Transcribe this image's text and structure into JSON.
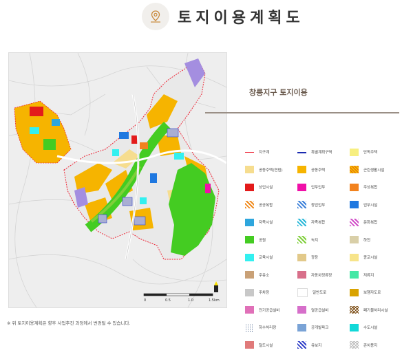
{
  "header": {
    "title": "토지이용계획도"
  },
  "subtitle": "창릉지구 토지이용",
  "note": "※ 위 토지이용계획은 향후 사업추진 과정에서 변경될 수 있습니다.",
  "scale": {
    "ticks": [
      "0",
      "0.5",
      "1.0",
      "1.5km"
    ]
  },
  "legend": [
    {
      "label": "지구계",
      "kind": "redline"
    },
    {
      "label": "특별계획구역",
      "kind": "navyline"
    },
    {
      "label": "단독주택",
      "color": "#f7ef80"
    },
    {
      "label": "공동주택(연립)",
      "color": "#f6dd8f"
    },
    {
      "label": "공동주택",
      "color": "#f6b400"
    },
    {
      "label": "근린생활시설",
      "kind": "cross"
    },
    {
      "label": "상업시설",
      "color": "#e31b1b"
    },
    {
      "label": "업무업무",
      "color": "#f010a8"
    },
    {
      "label": "주상복합",
      "color": "#f2821e"
    },
    {
      "label": "공공복합",
      "kind": "hatch-o"
    },
    {
      "label": "창업업무",
      "kind": "hatch-b"
    },
    {
      "label": "업무시설",
      "color": "#1f78e0"
    },
    {
      "label": "자족시설",
      "color": "#2ea6dd"
    },
    {
      "label": "자족복합",
      "kind": "hatch-c"
    },
    {
      "label": "문화복합",
      "kind": "hatch-m"
    },
    {
      "label": "공원",
      "color": "#44cc22"
    },
    {
      "label": "녹지",
      "kind": "hatch-g"
    },
    {
      "label": "하천",
      "color": "#d9cfa8"
    },
    {
      "label": "교육시설",
      "color": "#33f0f0"
    },
    {
      "label": "광장",
      "color": "#e2c98a"
    },
    {
      "label": "종교시설",
      "color": "#f7e48a"
    },
    {
      "label": "주유소",
      "color": "#c9a177"
    },
    {
      "label": "자동차정류장",
      "color": "#d86f8a"
    },
    {
      "label": "저류지",
      "color": "#44e8a6"
    },
    {
      "label": "주차장",
      "color": "#c8c8c8"
    },
    {
      "label": "일반도로",
      "color": "#ffffff"
    },
    {
      "label": "보행자도로",
      "color": "#d9a300"
    },
    {
      "label": "전기공급설비",
      "color": "#e070b8"
    },
    {
      "label": "열공급설비",
      "color": "#d66fca"
    },
    {
      "label": "폐기물처리시설",
      "kind": "crossb"
    },
    {
      "label": "하수처리장",
      "kind": "dots"
    },
    {
      "label": "공개발파크",
      "color": "#7aa3d6"
    },
    {
      "label": "수도시설",
      "color": "#12d8d8"
    },
    {
      "label": "철도시설",
      "color": "#e07a7a"
    },
    {
      "label": "유보지",
      "kind": "hatch-n"
    },
    {
      "label": "존치용지",
      "kind": "checker"
    }
  ]
}
